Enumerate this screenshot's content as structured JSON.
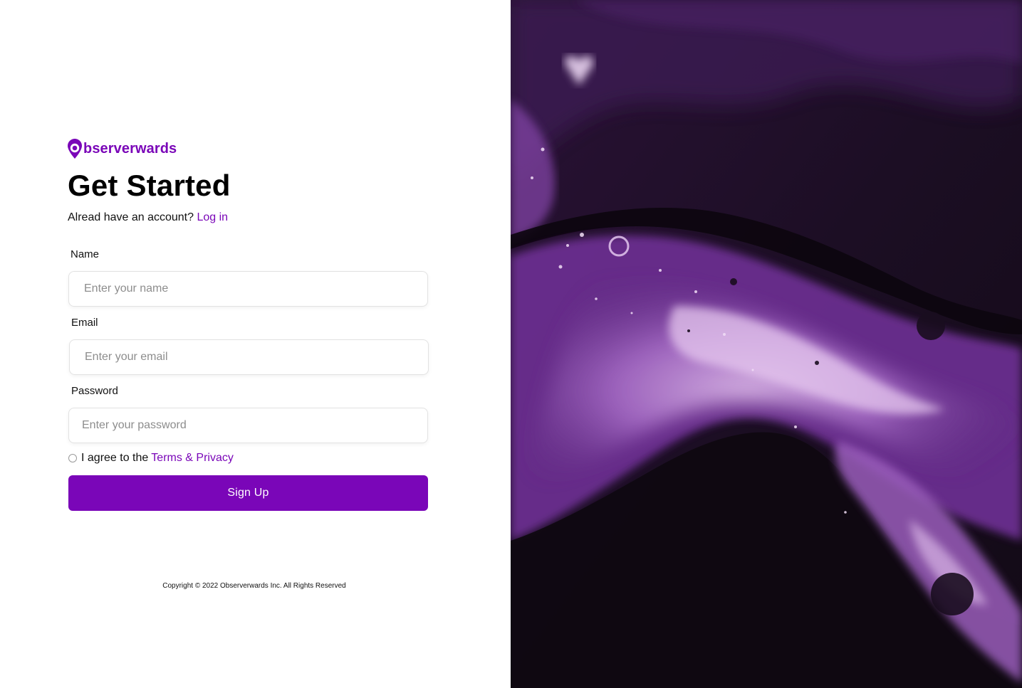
{
  "brand": {
    "name": "bserverwards",
    "color": "#7a06b8",
    "logo_icon": "map-pin-icon"
  },
  "header": {
    "title": "Get Started",
    "login_prompt": "Alread have an account?",
    "login_link": "Log in"
  },
  "form": {
    "name": {
      "label": "Name",
      "placeholder": "Enter your name",
      "value": ""
    },
    "email": {
      "label": "Email",
      "placeholder": "Enter your email",
      "value": ""
    },
    "password": {
      "label": "Password",
      "placeholder": "Enter your password",
      "value": ""
    },
    "agree": {
      "prefix": "I agree to the",
      "link": "Terms & Privacy",
      "checked": false
    },
    "submit_label": "Sign Up"
  },
  "footer": {
    "copyright": "Copyright © 2022 Observerwards Inc. All Rights Reserved"
  },
  "hero": {
    "description_icon": "abstract-purple-fluid-art",
    "colors": {
      "dark": "#1a0d1f",
      "purple": "#5b2a7e",
      "light": "#c89ad8"
    }
  }
}
